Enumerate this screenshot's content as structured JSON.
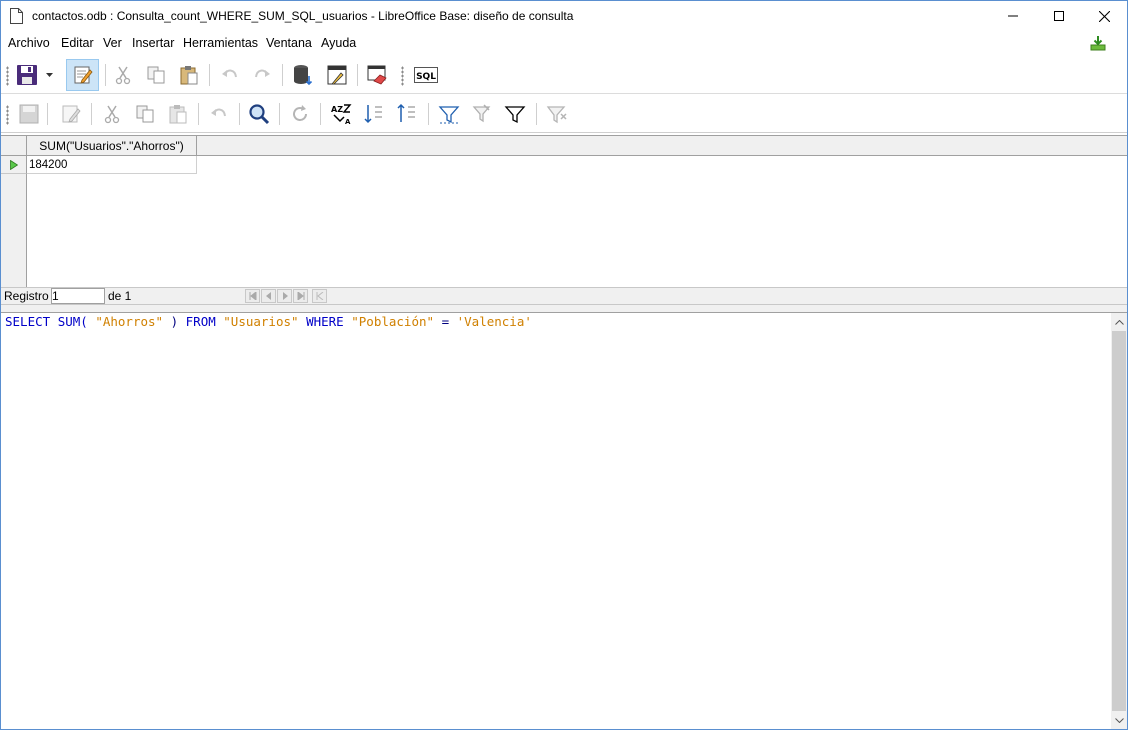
{
  "window": {
    "title": "contactos.odb : Consulta_count_WHERE_SUM_SQL_usuarios - LibreOffice Base: diseño de consulta"
  },
  "menu": {
    "items": [
      "Archivo",
      "Editar",
      "Ver",
      "Insertar",
      "Herramientas",
      "Ventana",
      "Ayuda"
    ]
  },
  "toolbar1": {
    "sql_button_label": "SQL"
  },
  "grid": {
    "columns": [
      "SUM(\"Usuarios\".\"Ahorros\")"
    ],
    "rows": [
      [
        "184200"
      ]
    ]
  },
  "navigation": {
    "record_label": "Registro",
    "record_value": "1",
    "of_label": "de 1"
  },
  "sql": {
    "tokens": [
      {
        "text": "SELECT",
        "kind": "kw"
      },
      {
        "text": " ",
        "kind": "plain"
      },
      {
        "text": "SUM(",
        "kind": "kw"
      },
      {
        "text": " ",
        "kind": "plain"
      },
      {
        "text": "\"Ahorros\"",
        "kind": "str"
      },
      {
        "text": " ) ",
        "kind": "op"
      },
      {
        "text": "FROM",
        "kind": "kw"
      },
      {
        "text": " ",
        "kind": "plain"
      },
      {
        "text": "\"Usuarios\"",
        "kind": "str"
      },
      {
        "text": " ",
        "kind": "plain"
      },
      {
        "text": "WHERE",
        "kind": "kw"
      },
      {
        "text": " ",
        "kind": "plain"
      },
      {
        "text": "\"Población\"",
        "kind": "str"
      },
      {
        "text": " = ",
        "kind": "op"
      },
      {
        "text": "'Valencia'",
        "kind": "str"
      }
    ]
  },
  "colors": {
    "window_border": "#5a8fd0",
    "keyword": "#0000c8",
    "string": "#d08000",
    "pressed_bg": "#cce4f7"
  }
}
